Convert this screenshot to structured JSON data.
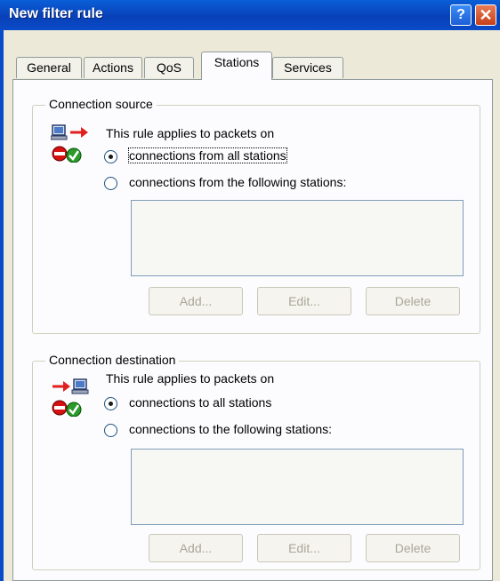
{
  "window": {
    "title": "New filter rule",
    "help_glyph": "?",
    "close_glyph": "✕"
  },
  "tabs": [
    {
      "label": "General"
    },
    {
      "label": "Actions"
    },
    {
      "label": "QoS"
    },
    {
      "label": "Stations",
      "active": true
    },
    {
      "label": "Services"
    }
  ],
  "source": {
    "legend": "Connection source",
    "description": "This rule applies to packets on",
    "option_all": "connections from all stations",
    "option_following": "connections from the following stations:",
    "selected": "all",
    "buttons": {
      "add": "Add...",
      "edit": "Edit...",
      "delete": "Delete"
    }
  },
  "destination": {
    "legend": "Connection destination",
    "description": "This rule applies to packets on",
    "option_all": "connections to all stations",
    "option_following": "connections to the following stations:",
    "selected": "all",
    "buttons": {
      "add": "Add...",
      "edit": "Edit...",
      "delete": "Delete"
    }
  },
  "colors": {
    "titlebar": "#0a4bc8",
    "dialog_bg": "#ece9d8",
    "panel_bg": "#fcfcfe",
    "disabled_text": "#a9a79a"
  }
}
